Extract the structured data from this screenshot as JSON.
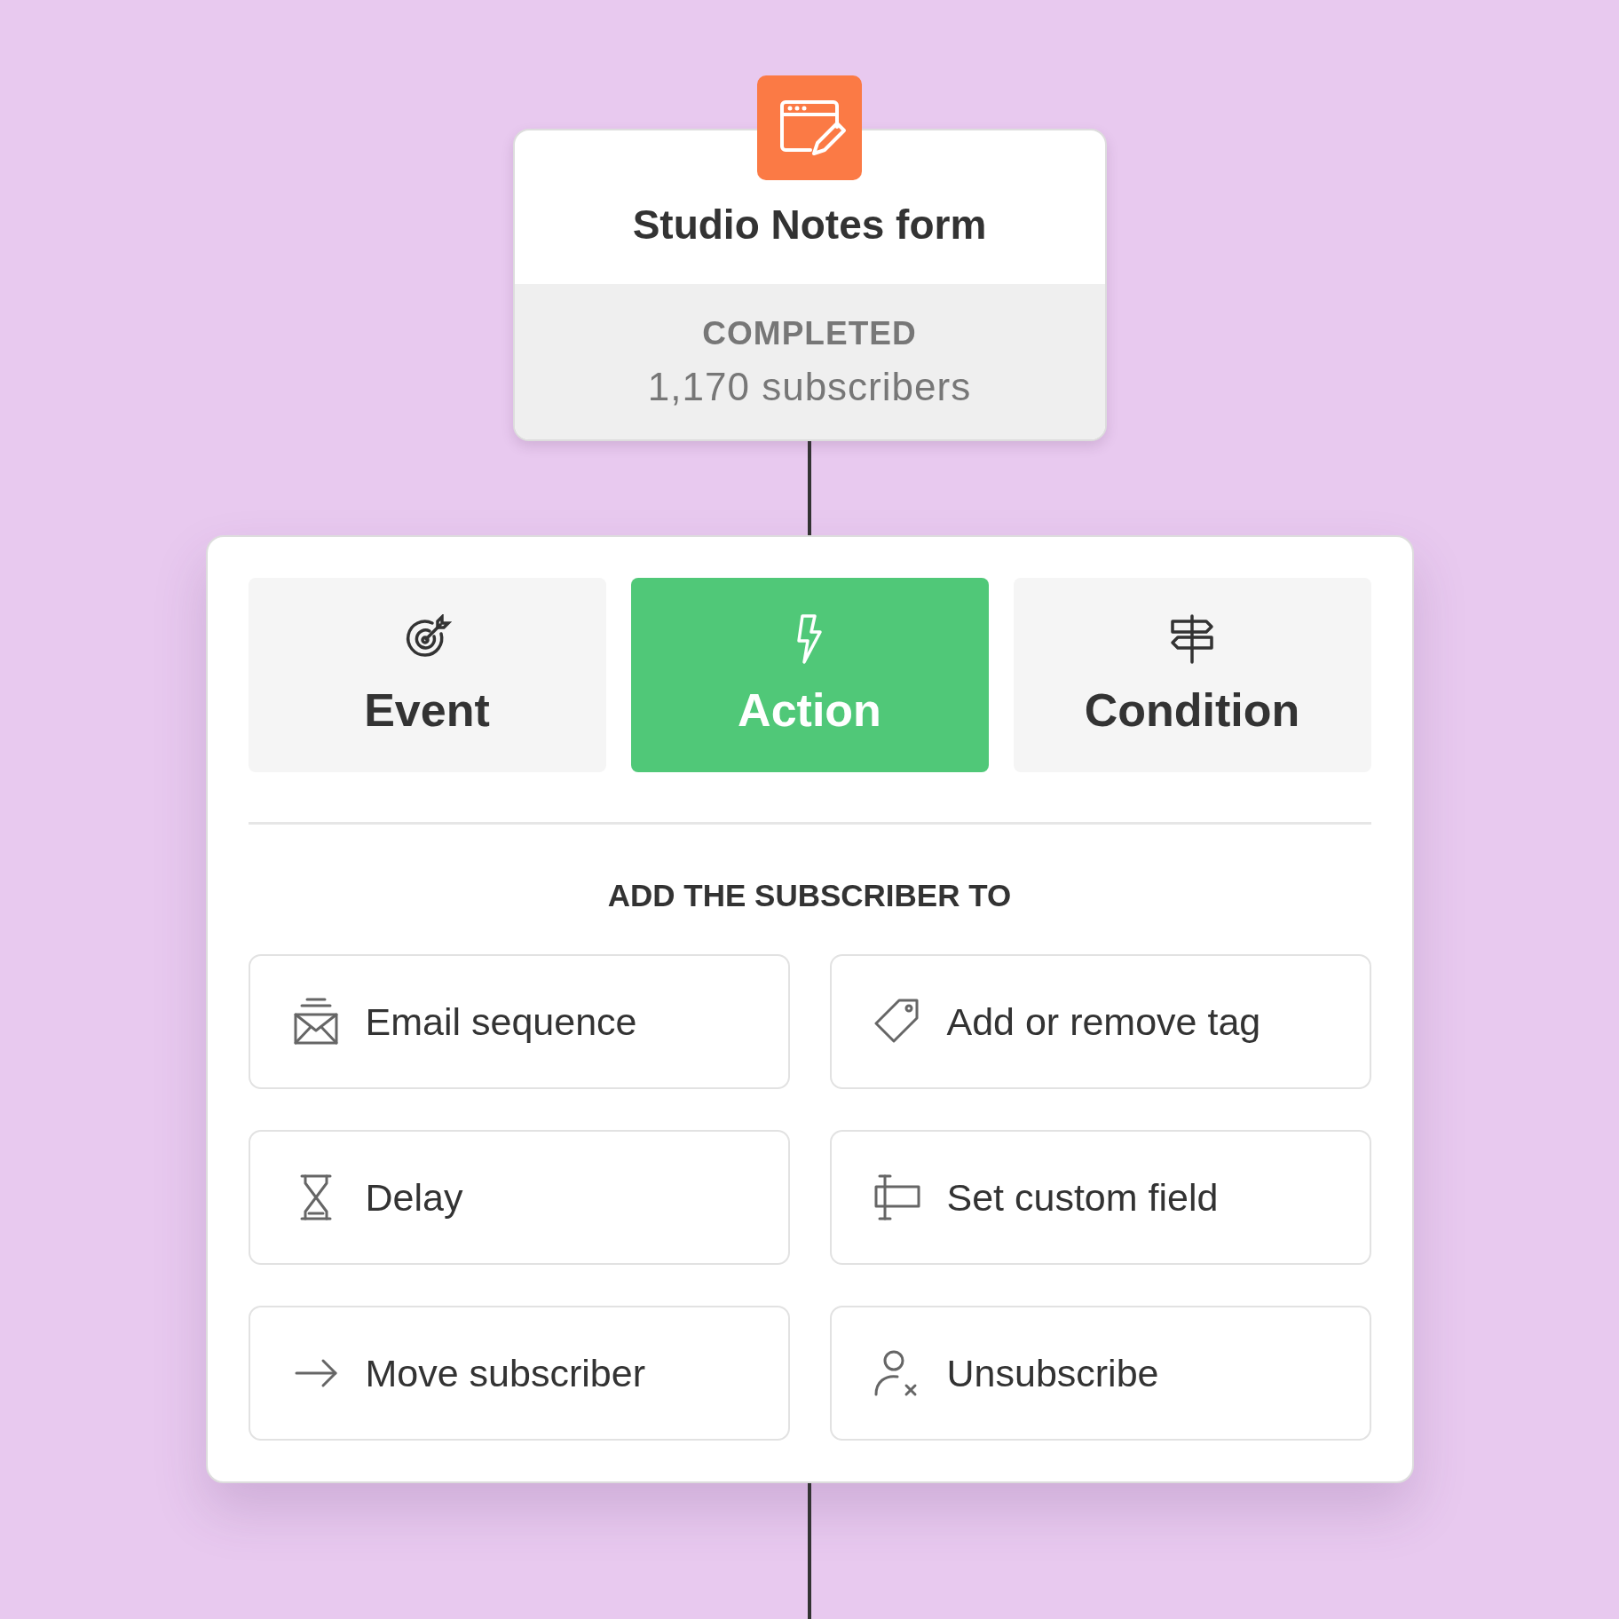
{
  "trigger_node": {
    "title": "Studio Notes form",
    "status": "COMPLETED",
    "count": "1,170 subscribers"
  },
  "tabs": [
    {
      "label": "Event",
      "selected": false
    },
    {
      "label": "Action",
      "selected": true
    },
    {
      "label": "Condition",
      "selected": false
    }
  ],
  "section_heading": "ADD THE SUBSCRIBER TO",
  "options": [
    {
      "label": "Email sequence"
    },
    {
      "label": "Add or remove tag"
    },
    {
      "label": "Delay"
    },
    {
      "label": "Set custom field"
    },
    {
      "label": "Move subscriber"
    },
    {
      "label": "Unsubscribe"
    }
  ]
}
